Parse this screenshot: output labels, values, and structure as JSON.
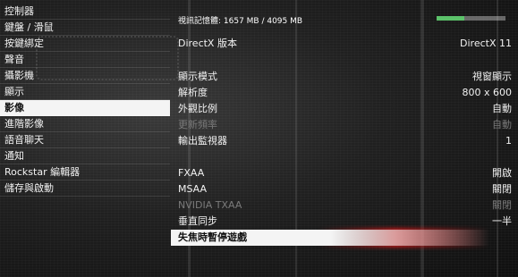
{
  "left_menu": [
    {
      "label": "控制器"
    },
    {
      "label": "鍵盤 / 滑鼠"
    },
    {
      "label": "按鍵綁定"
    },
    {
      "label": "聲音"
    },
    {
      "label": "攝影機"
    },
    {
      "label": "顯示"
    },
    {
      "label": "影像",
      "selected": true
    },
    {
      "label": "進階影像"
    },
    {
      "label": "語音聊天"
    },
    {
      "label": "通知"
    },
    {
      "label": "Rockstar 編輯器"
    },
    {
      "label": "儲存與啟動"
    }
  ],
  "vram": {
    "text": "視訊記憶體: 1657 MB / 4095 MB",
    "usage_fraction": 0.4,
    "bar_color": "#5cc26a"
  },
  "settings": [
    {
      "label": "DirectX 版本",
      "value": "DirectX 11",
      "state": "normal"
    },
    {
      "label": "顯示模式",
      "value": "視窗顯示",
      "state": "normal"
    },
    {
      "label": "解析度",
      "value": "800 x 600",
      "state": "normal"
    },
    {
      "label": "外觀比例",
      "value": "自動",
      "state": "normal"
    },
    {
      "label": "更新頻率",
      "value": "自動",
      "state": "disabled"
    },
    {
      "label": "輸出監視器",
      "value": "1",
      "state": "normal"
    },
    {
      "label": "FXAA",
      "value": "開啟",
      "state": "normal"
    },
    {
      "label": "MSAA",
      "value": "關閉",
      "state": "normal"
    },
    {
      "label": "NVIDIA TXAA",
      "value": "關閉",
      "state": "disabled"
    },
    {
      "label": "垂直同步",
      "value": "一半",
      "state": "normal"
    },
    {
      "label": "失焦時暫停遊戲",
      "value": "",
      "state": "highlight"
    }
  ],
  "colors": {
    "selected_bg": "#f4f4f4",
    "highlight_mark": "#d21919",
    "disabled_text": "#7a7a7a"
  }
}
